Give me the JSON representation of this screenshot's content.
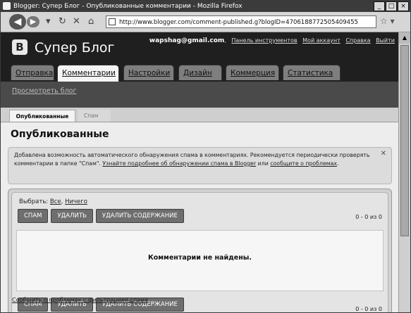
{
  "window": {
    "title": "Blogger: Супер Блог - Опубликованные комментарии - Mozilla Firefox",
    "controls": [
      "_",
      "□",
      "×"
    ]
  },
  "browser": {
    "url": "http://www.blogger.com/comment-published.g?blogID=4706188772505409455"
  },
  "blog": {
    "name": "Супер Блог",
    "logo_letter": "B",
    "email": "wapshag@gmail.com",
    "top_links": [
      "Панель инструментов",
      "Мой аккаунт",
      "Справка",
      "Выйти"
    ]
  },
  "tabs": [
    "Отправка",
    "Комментарии",
    "Настройки",
    "Дизайн",
    "Коммерция",
    "Статистика"
  ],
  "active_tab": "Комментарии",
  "view_blog": "Просмотреть блог",
  "subtabs": [
    "Опубликованные",
    "Спам"
  ],
  "page_title": "Опубликованные",
  "notice": {
    "text_before": "Добавлена возможность автоматического обнаружения спама в комментариях. Рекомендуется периодически проверять комментарии в папке \"Спам\". ",
    "link1": "Узнайте подробнее об обнаружении спама в Blogger",
    "middle": " или ",
    "link2": "сообщите о проблемах",
    "end": "."
  },
  "selection": {
    "label": "Выбрать:",
    "all": "Все",
    "none": "Ничего"
  },
  "actions": [
    "СПАМ",
    "УДАЛИТЬ",
    "УДАЛИТЬ СОДЕРЖАНИЕ"
  ],
  "counter": "0 - 0 из 0",
  "empty_message": "Комментарии не найдены.",
  "footer_link": "Сообщить о проблемах с фильтрацией спама"
}
